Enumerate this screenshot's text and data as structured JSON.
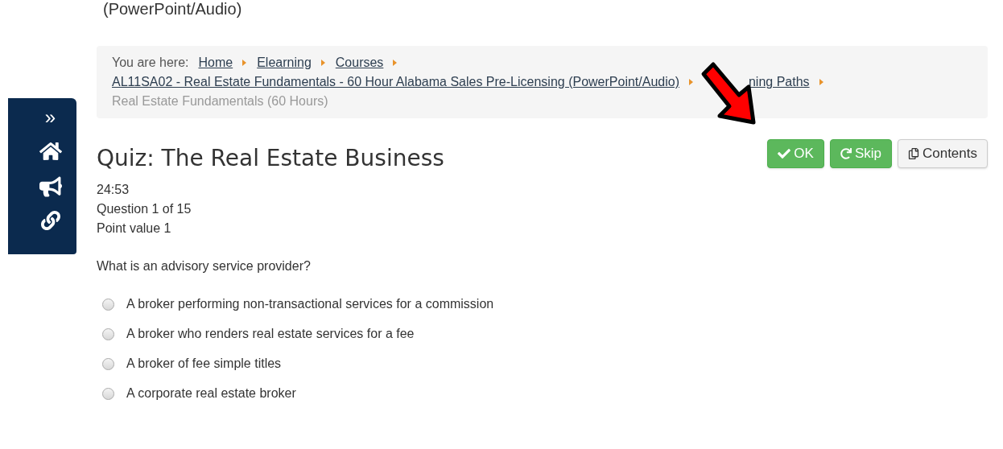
{
  "page_heading_fragment": "(PowerPoint/Audio)",
  "sidebar": {
    "items": [
      {
        "kind": "expand",
        "label": "»"
      },
      {
        "kind": "home"
      },
      {
        "kind": "announce"
      },
      {
        "kind": "link"
      }
    ]
  },
  "breadcrumb": {
    "prefix": "You are here:",
    "links": [
      {
        "label": "Home"
      },
      {
        "label": "Elearning"
      },
      {
        "label": "Courses"
      },
      {
        "label": "AL11SA02 - Real Estate Fundamentals - 60 Hour Alabama Sales Pre-Licensing (PowerPoint/Audio)"
      },
      {
        "label": "ning Paths"
      }
    ],
    "current": "Real Estate Fundamentals (60 Hours)"
  },
  "quiz": {
    "title": "Quiz: The Real Estate Business",
    "timer": "24:53",
    "question_number": "Question 1 of 15",
    "points": "Point value 1",
    "question": "What is an advisory service provider?",
    "options": [
      {
        "label": "A broker performing non-transactional services for a commission",
        "selected": false
      },
      {
        "label": "A broker who renders real estate services for a fee",
        "selected": false
      },
      {
        "label": "A broker of fee simple titles",
        "selected": false
      },
      {
        "label": "A corporate real estate broker",
        "selected": false
      }
    ]
  },
  "buttons": [
    {
      "kind": "ok",
      "label": "OK"
    },
    {
      "kind": "skip",
      "label": "Skip"
    },
    {
      "kind": "contents",
      "label": "Contents"
    }
  ]
}
